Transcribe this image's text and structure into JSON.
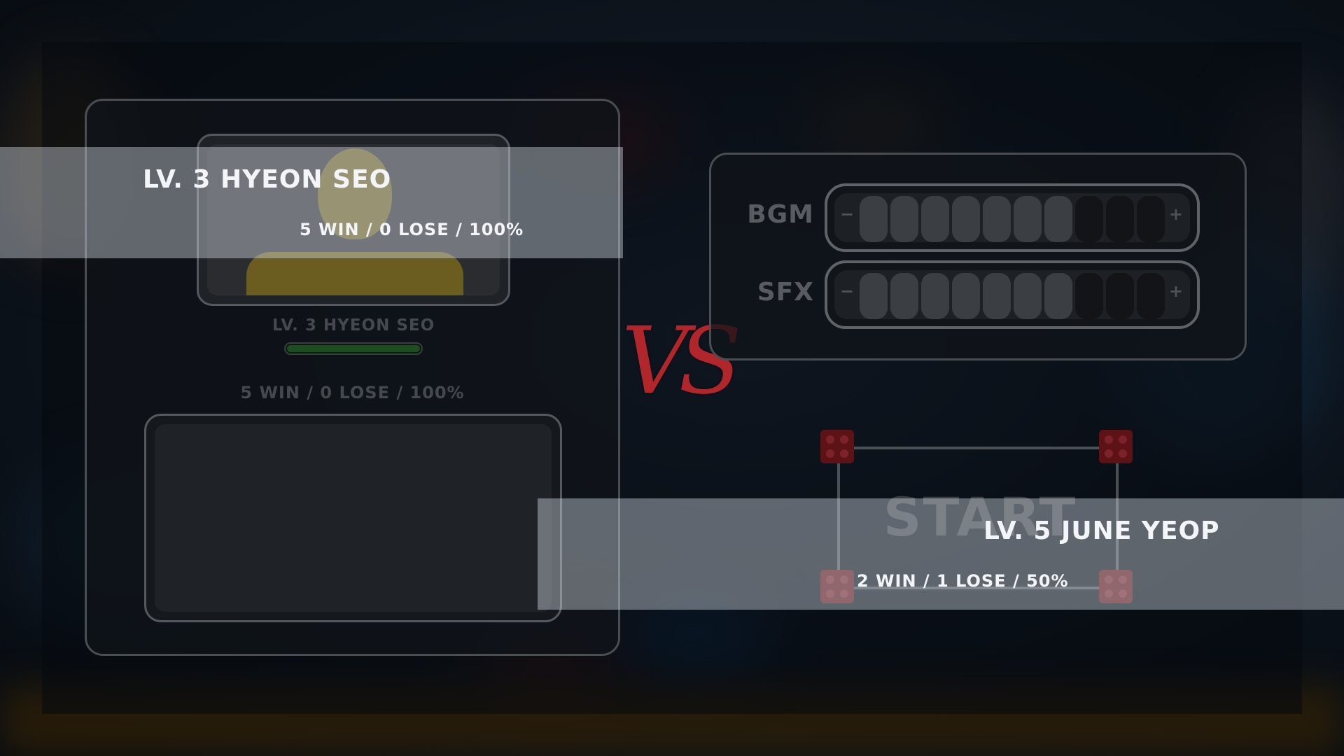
{
  "player_one": {
    "banner_name": "LV. 3 HYEON SEO",
    "banner_record": "5 WIN / 0 LOSE / 100%",
    "panel_name": "LV. 3 HYEON SEO",
    "panel_record": "5 WIN / 0 LOSE / 100%",
    "exp_progress": 1.0
  },
  "player_two": {
    "banner_name": "LV. 5  JUNE YEOP",
    "banner_record": "2 WIN / 1 LOSE / 50%"
  },
  "versus": {
    "label": "VS"
  },
  "settings": {
    "bgm": {
      "label": "BGM",
      "minus": "−",
      "plus": "+",
      "level": 7,
      "max": 10
    },
    "sfx": {
      "label": "SFX",
      "minus": "−",
      "plus": "+",
      "level": 7,
      "max": 10
    }
  },
  "start_button": {
    "label": "START"
  },
  "colors": {
    "vs_red": "#b1262b",
    "dice_red": "#5d1216",
    "silhouette_gold": "#6b5d1f",
    "exp_green": "#1e4d22"
  }
}
